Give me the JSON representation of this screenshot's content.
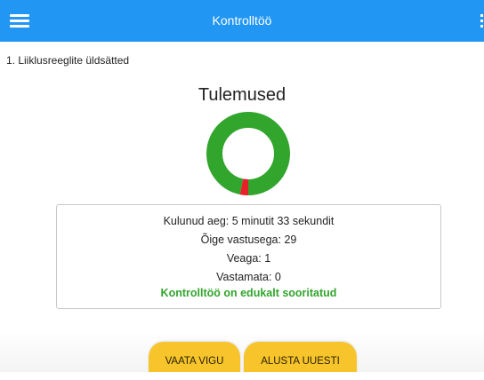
{
  "header": {
    "title": "Kontrolltöö",
    "menu_icon": "hamburger-menu-icon",
    "more_icon": "more-vertical-icon",
    "color": "#2196f3"
  },
  "test": {
    "name": "1. Liiklusreeglite üldsätted"
  },
  "results": {
    "heading": "Tulemused",
    "chart_data": {
      "type": "pie",
      "series": [
        {
          "name": "Õige",
          "value": 29,
          "color": "#31a52c"
        },
        {
          "name": "Vead",
          "value": 1,
          "color": "#e8202a"
        },
        {
          "name": "Vastamata",
          "value": 0,
          "color": "#cccccc"
        }
      ]
    }
  },
  "summary": {
    "elapsed": "Kulunud aeg: 5 minutit 33 sekundit",
    "correct": "Õige vastusega: 29",
    "wrong": "Veaga: 1",
    "unanswered": "Vastamata: 0",
    "status": "Kontrolltöö on edukalt sooritatud",
    "status_color": "#31a52c"
  },
  "actions": {
    "view_mistakes": "VAATA VIGU",
    "restart": "ALUSTA UUESTI",
    "button_color": "#f7c52b"
  }
}
